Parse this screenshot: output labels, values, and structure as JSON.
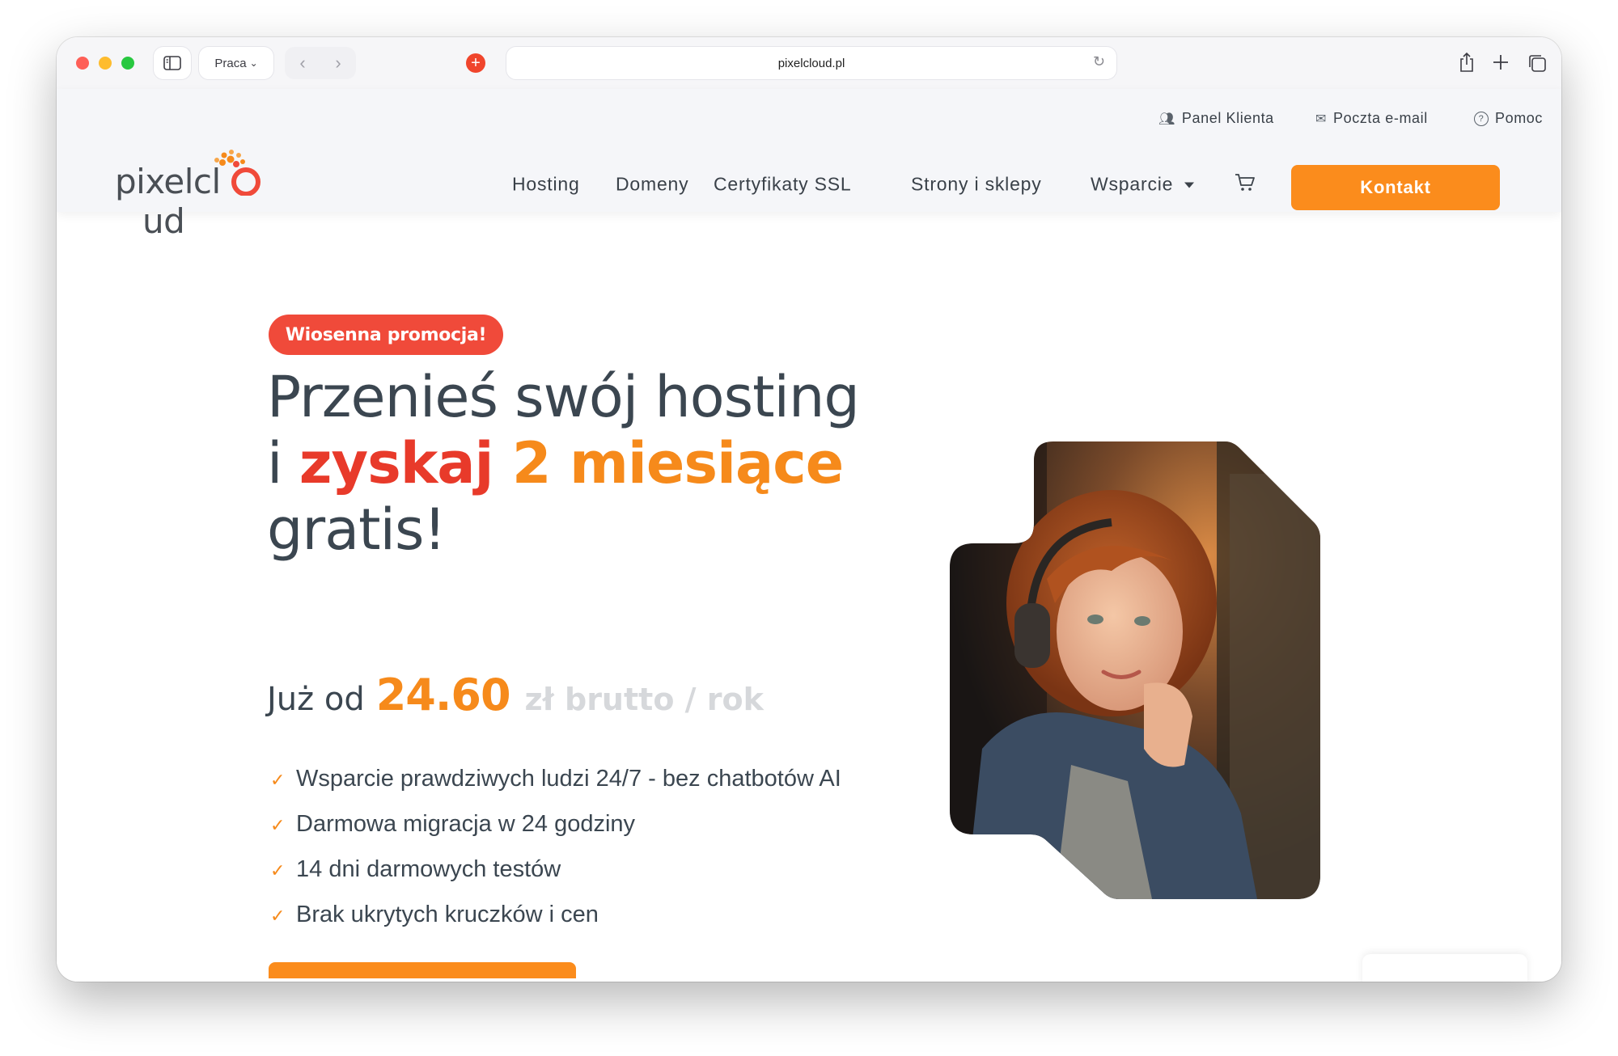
{
  "browser": {
    "profile_label": "Praca",
    "url": "pixelcloud.pl"
  },
  "header": {
    "utility": {
      "client_panel": "Panel Klienta",
      "email": "Poczta e-mail",
      "help": "Pomoc"
    },
    "logo_text": "pixelcloud",
    "nav": {
      "hosting": "Hosting",
      "domains": "Domeny",
      "ssl": "Certyfikaty SSL",
      "sites": "Strony i sklepy",
      "support": "Wsparcie"
    },
    "contact_label": "Kontakt"
  },
  "hero": {
    "promo_badge": "Wiosenna promocja!",
    "headline": {
      "line1": "Przenieś swój hosting",
      "line2_prefix": "i ",
      "line2_red": "zyskaj",
      "line2_orange": " 2 miesiące",
      "line3": "gratis!"
    },
    "price": {
      "prefix": "Już od",
      "value": "24.60",
      "suffix": "zł brutto / rok"
    },
    "features": [
      "Wsparcie prawdziwych ludzi 24/7 - bez chatbotów AI",
      "Darmowa migracja w 24 godziny",
      "14 dni darmowych testów",
      "Brak ukrytych kruczków i cen"
    ]
  },
  "colors": {
    "accent_orange": "#fb8c1c",
    "promo_red": "#f04a3a",
    "text_dark": "#3b4650"
  }
}
